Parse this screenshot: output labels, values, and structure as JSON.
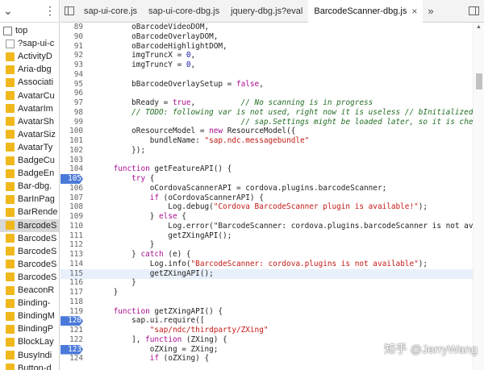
{
  "tree": {
    "items": [
      {
        "label": "top",
        "icon": "top"
      },
      {
        "label": "?sap-ui-c",
        "icon": "file"
      },
      {
        "label": "ActivityD",
        "icon": "folder"
      },
      {
        "label": "Aria-dbg",
        "icon": "folder"
      },
      {
        "label": "Associati",
        "icon": "folder"
      },
      {
        "label": "AvatarCu",
        "icon": "folder"
      },
      {
        "label": "AvatarIm",
        "icon": "folder"
      },
      {
        "label": "AvatarSh",
        "icon": "folder"
      },
      {
        "label": "AvatarSiz",
        "icon": "folder"
      },
      {
        "label": "AvatarTy",
        "icon": "folder"
      },
      {
        "label": "BadgeCu",
        "icon": "folder"
      },
      {
        "label": "BadgeEn",
        "icon": "folder"
      },
      {
        "label": "Bar-dbg.",
        "icon": "folder"
      },
      {
        "label": "BarInPag",
        "icon": "folder"
      },
      {
        "label": "BarRende",
        "icon": "folder"
      },
      {
        "label": "BarcodeS",
        "icon": "folder",
        "selected": true
      },
      {
        "label": "BarcodeS",
        "icon": "folder"
      },
      {
        "label": "BarcodeS",
        "icon": "folder"
      },
      {
        "label": "BarcodeS",
        "icon": "folder"
      },
      {
        "label": "BarcodeS",
        "icon": "folder"
      },
      {
        "label": "BeaconR",
        "icon": "folder"
      },
      {
        "label": "Binding-",
        "icon": "folder"
      },
      {
        "label": "BindingM",
        "icon": "folder"
      },
      {
        "label": "BindingP",
        "icon": "folder"
      },
      {
        "label": "BlockLay",
        "icon": "folder"
      },
      {
        "label": "BusyIndi",
        "icon": "folder"
      },
      {
        "label": "Button-d",
        "icon": "folder"
      }
    ]
  },
  "tabs": [
    {
      "label": "sap-ui-core.js",
      "active": false
    },
    {
      "label": "sap-ui-core-dbg.js",
      "active": false
    },
    {
      "label": "jquery-dbg.js?eval",
      "active": false
    },
    {
      "label": "BarcodeScanner-dbg.js",
      "active": true
    }
  ],
  "tab_close": "×",
  "tab_more": "»",
  "code": [
    {
      "n": "89",
      "html": "        oBarcodeVideoDOM,"
    },
    {
      "n": "90",
      "html": "        oBarcodeOverlayDOM,"
    },
    {
      "n": "91",
      "html": "        oBarcodeHighlightDOM,"
    },
    {
      "n": "92",
      "html": "        imgTruncX = 0,"
    },
    {
      "n": "93",
      "html": "        imgTruncY = 0,"
    },
    {
      "n": "94",
      "html": ""
    },
    {
      "n": "95",
      "html": "        bBarcodeOverlaySetup = false,"
    },
    {
      "n": "96",
      "html": ""
    },
    {
      "n": "97",
      "html": "        bReady = true,          // No scanning is in progress"
    },
    {
      "n": "98",
      "html": "        // TODO: following var is not used, right now it is useless // bInitialized = fa"
    },
    {
      "n": "99",
      "html": "                                // sap.Settings might be loaded later, so it is checked"
    },
    {
      "n": "100",
      "html": "        oResourceModel = new ResourceModel({"
    },
    {
      "n": "101",
      "html": "            bundleName: \"sap.ndc.messagebundle\""
    },
    {
      "n": "102",
      "html": "        });"
    },
    {
      "n": "103",
      "html": ""
    },
    {
      "n": "104",
      "html": "    function getFeatureAPI() {"
    },
    {
      "n": "105",
      "html": "        try {",
      "bp": true
    },
    {
      "n": "106",
      "html": "            oCordovaScannerAPI = cordova.plugins.barcodeScanner;"
    },
    {
      "n": "107",
      "html": "            if (oCordovaScannerAPI) {"
    },
    {
      "n": "108",
      "html": "                Log.debug(\"Cordova BarcodeScanner plugin is available!\");"
    },
    {
      "n": "109",
      "html": "            } else {"
    },
    {
      "n": "110",
      "html": "                Log.error(\"BarcodeScanner: cordova.plugins.barcodeScanner is not availab"
    },
    {
      "n": "111",
      "html": "                getZXingAPI();"
    },
    {
      "n": "112",
      "html": "            }"
    },
    {
      "n": "113",
      "html": "        } catch (e) {"
    },
    {
      "n": "114",
      "html": "            Log.info(\"BarcodeScanner: cordova.plugins is not available\");"
    },
    {
      "n": "115",
      "html": "            getZXingAPI();",
      "hl": true
    },
    {
      "n": "116",
      "html": "        }"
    },
    {
      "n": "117",
      "html": "    }"
    },
    {
      "n": "118",
      "html": ""
    },
    {
      "n": "119",
      "html": "    function getZXingAPI() {"
    },
    {
      "n": "120",
      "html": "        sap.ui.require([",
      "bp": true
    },
    {
      "n": "121",
      "html": "            \"sap/ndc/thirdparty/ZXing\""
    },
    {
      "n": "122",
      "html": "        ], function (ZXing) {"
    },
    {
      "n": "123",
      "html": "            oZXing = ZXing;",
      "bp": true
    },
    {
      "n": "124",
      "html": "            if (oZXing) {"
    }
  ],
  "watermark": "知乎 @JerryWang"
}
